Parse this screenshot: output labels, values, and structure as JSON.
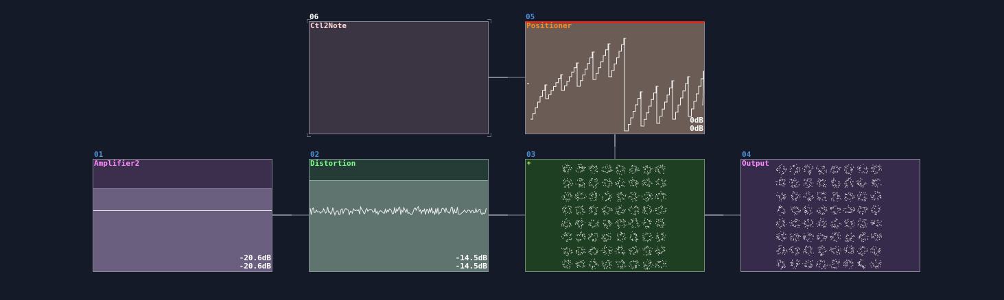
{
  "colors": {
    "background": "#141a27",
    "module_number": "#4f8fd8",
    "ctl2note_name": "#ffd7d7",
    "positioner_name": "#ff8a1e",
    "amplifier_name": "#ff8cff",
    "distortion_name": "#7dff8a",
    "output_name": "#ff8cff"
  },
  "modules": {
    "ctl2note": {
      "number": "06",
      "name": "Ctl2Note"
    },
    "positioner": {
      "number": "05",
      "name": "Positioner",
      "level_l": "0dB",
      "level_r": "0dB"
    },
    "amplifier": {
      "number": "01",
      "name": "Amplifier2",
      "level_l": "-20.6dB",
      "level_r": "-20.6dB"
    },
    "distortion": {
      "number": "02",
      "name": "Distortion",
      "level_l": "-14.5dB",
      "level_r": "-14.5dB"
    },
    "visualizer": {
      "number": "03",
      "name": "",
      "add_glyph": "+"
    },
    "output": {
      "number": "04",
      "name": "Output"
    }
  }
}
